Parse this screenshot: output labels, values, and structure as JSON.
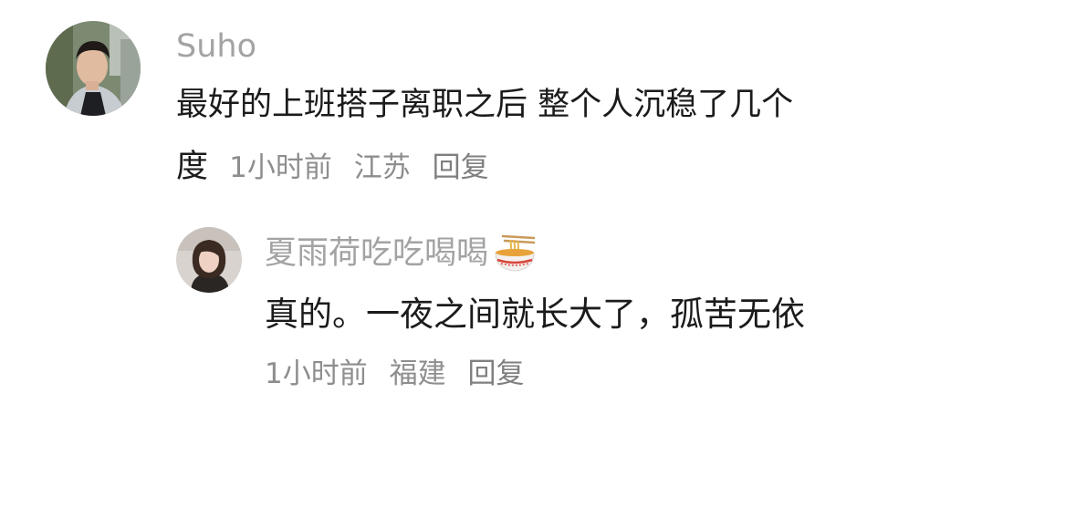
{
  "comment": {
    "username": "Suho",
    "text_line1": "最好的上班搭子离职之后 整个人沉稳了几个",
    "text_line2": "度",
    "time": "1小时前",
    "location": "江苏",
    "reply_label": "回复"
  },
  "reply": {
    "username": "夏雨荷吃吃喝喝",
    "username_emoji": "noodle-bowl-icon",
    "text": "真的。一夜之间就长大了，孤苦无依",
    "time": "1小时前",
    "location": "福建",
    "reply_label": "回复"
  }
}
